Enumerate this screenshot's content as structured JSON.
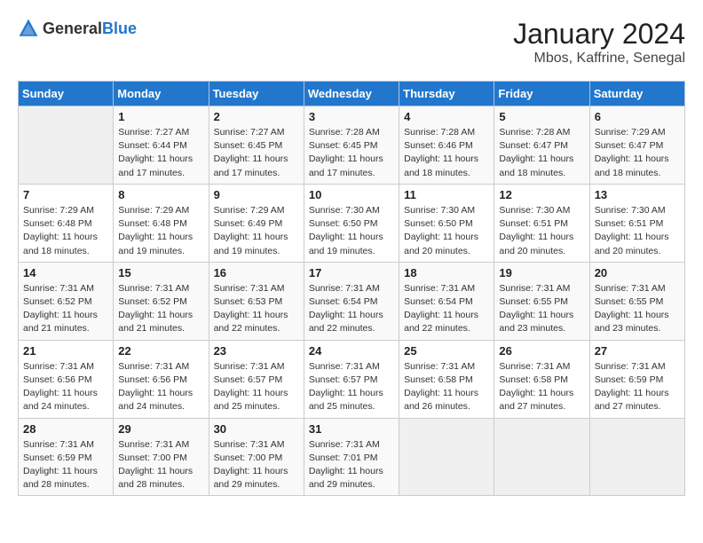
{
  "header": {
    "logo": {
      "general": "General",
      "blue": "Blue"
    },
    "title": "January 2024",
    "subtitle": "Mbos, Kaffrine, Senegal"
  },
  "calendar": {
    "weekdays": [
      "Sunday",
      "Monday",
      "Tuesday",
      "Wednesday",
      "Thursday",
      "Friday",
      "Saturday"
    ],
    "weeks": [
      [
        {
          "day": null,
          "info": null
        },
        {
          "day": "1",
          "info": "Sunrise: 7:27 AM\nSunset: 6:44 PM\nDaylight: 11 hours and 17 minutes."
        },
        {
          "day": "2",
          "info": "Sunrise: 7:27 AM\nSunset: 6:45 PM\nDaylight: 11 hours and 17 minutes."
        },
        {
          "day": "3",
          "info": "Sunrise: 7:28 AM\nSunset: 6:45 PM\nDaylight: 11 hours and 17 minutes."
        },
        {
          "day": "4",
          "info": "Sunrise: 7:28 AM\nSunset: 6:46 PM\nDaylight: 11 hours and 18 minutes."
        },
        {
          "day": "5",
          "info": "Sunrise: 7:28 AM\nSunset: 6:47 PM\nDaylight: 11 hours and 18 minutes."
        },
        {
          "day": "6",
          "info": "Sunrise: 7:29 AM\nSunset: 6:47 PM\nDaylight: 11 hours and 18 minutes."
        }
      ],
      [
        {
          "day": "7",
          "info": "Sunrise: 7:29 AM\nSunset: 6:48 PM\nDaylight: 11 hours and 18 minutes."
        },
        {
          "day": "8",
          "info": "Sunrise: 7:29 AM\nSunset: 6:48 PM\nDaylight: 11 hours and 19 minutes."
        },
        {
          "day": "9",
          "info": "Sunrise: 7:29 AM\nSunset: 6:49 PM\nDaylight: 11 hours and 19 minutes."
        },
        {
          "day": "10",
          "info": "Sunrise: 7:30 AM\nSunset: 6:50 PM\nDaylight: 11 hours and 19 minutes."
        },
        {
          "day": "11",
          "info": "Sunrise: 7:30 AM\nSunset: 6:50 PM\nDaylight: 11 hours and 20 minutes."
        },
        {
          "day": "12",
          "info": "Sunrise: 7:30 AM\nSunset: 6:51 PM\nDaylight: 11 hours and 20 minutes."
        },
        {
          "day": "13",
          "info": "Sunrise: 7:30 AM\nSunset: 6:51 PM\nDaylight: 11 hours and 20 minutes."
        }
      ],
      [
        {
          "day": "14",
          "info": "Sunrise: 7:31 AM\nSunset: 6:52 PM\nDaylight: 11 hours and 21 minutes."
        },
        {
          "day": "15",
          "info": "Sunrise: 7:31 AM\nSunset: 6:52 PM\nDaylight: 11 hours and 21 minutes."
        },
        {
          "day": "16",
          "info": "Sunrise: 7:31 AM\nSunset: 6:53 PM\nDaylight: 11 hours and 22 minutes."
        },
        {
          "day": "17",
          "info": "Sunrise: 7:31 AM\nSunset: 6:54 PM\nDaylight: 11 hours and 22 minutes."
        },
        {
          "day": "18",
          "info": "Sunrise: 7:31 AM\nSunset: 6:54 PM\nDaylight: 11 hours and 22 minutes."
        },
        {
          "day": "19",
          "info": "Sunrise: 7:31 AM\nSunset: 6:55 PM\nDaylight: 11 hours and 23 minutes."
        },
        {
          "day": "20",
          "info": "Sunrise: 7:31 AM\nSunset: 6:55 PM\nDaylight: 11 hours and 23 minutes."
        }
      ],
      [
        {
          "day": "21",
          "info": "Sunrise: 7:31 AM\nSunset: 6:56 PM\nDaylight: 11 hours and 24 minutes."
        },
        {
          "day": "22",
          "info": "Sunrise: 7:31 AM\nSunset: 6:56 PM\nDaylight: 11 hours and 24 minutes."
        },
        {
          "day": "23",
          "info": "Sunrise: 7:31 AM\nSunset: 6:57 PM\nDaylight: 11 hours and 25 minutes."
        },
        {
          "day": "24",
          "info": "Sunrise: 7:31 AM\nSunset: 6:57 PM\nDaylight: 11 hours and 25 minutes."
        },
        {
          "day": "25",
          "info": "Sunrise: 7:31 AM\nSunset: 6:58 PM\nDaylight: 11 hours and 26 minutes."
        },
        {
          "day": "26",
          "info": "Sunrise: 7:31 AM\nSunset: 6:58 PM\nDaylight: 11 hours and 27 minutes."
        },
        {
          "day": "27",
          "info": "Sunrise: 7:31 AM\nSunset: 6:59 PM\nDaylight: 11 hours and 27 minutes."
        }
      ],
      [
        {
          "day": "28",
          "info": "Sunrise: 7:31 AM\nSunset: 6:59 PM\nDaylight: 11 hours and 28 minutes."
        },
        {
          "day": "29",
          "info": "Sunrise: 7:31 AM\nSunset: 7:00 PM\nDaylight: 11 hours and 28 minutes."
        },
        {
          "day": "30",
          "info": "Sunrise: 7:31 AM\nSunset: 7:00 PM\nDaylight: 11 hours and 29 minutes."
        },
        {
          "day": "31",
          "info": "Sunrise: 7:31 AM\nSunset: 7:01 PM\nDaylight: 11 hours and 29 minutes."
        },
        {
          "day": null,
          "info": null
        },
        {
          "day": null,
          "info": null
        },
        {
          "day": null,
          "info": null
        }
      ]
    ]
  }
}
